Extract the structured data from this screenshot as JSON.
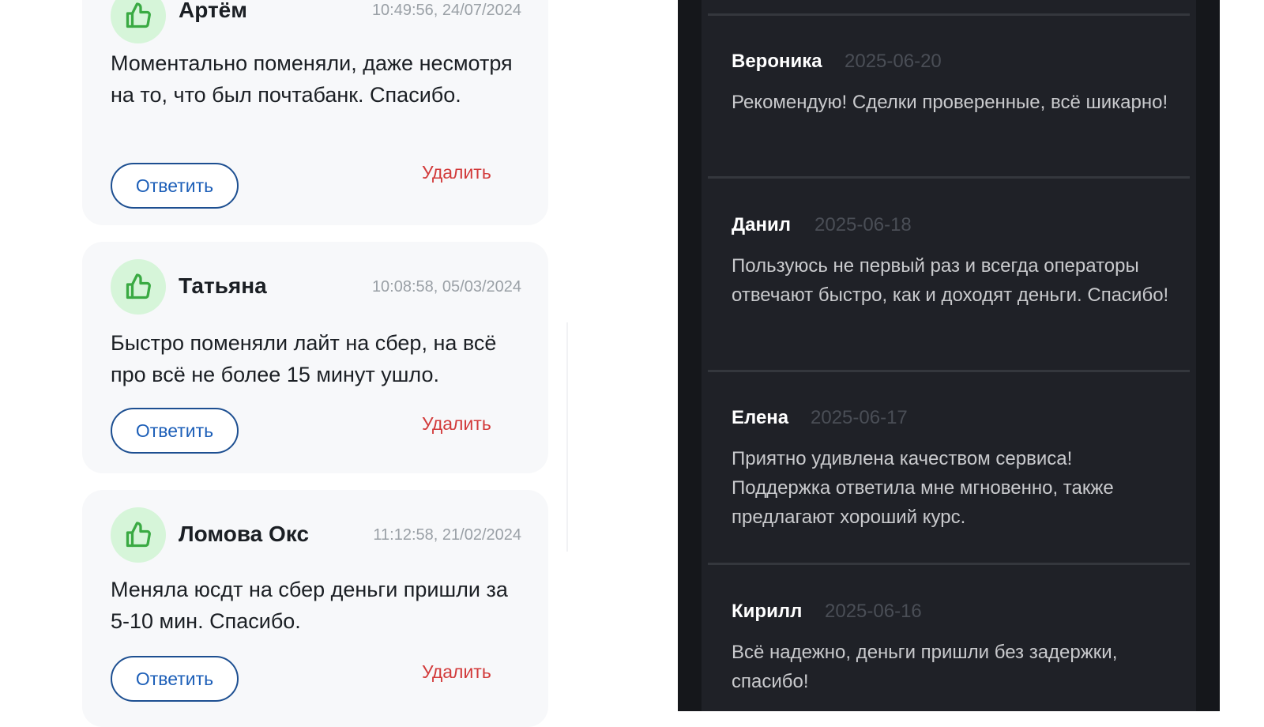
{
  "reviews_light": [
    {
      "name": "Артём",
      "date": "10:49:56, 24/07/2024",
      "text": "Моментально поменяли, даже несмотря на то, что был почтабанк. Спасибо.",
      "reply_label": "Ответить",
      "delete_label": "Удалить"
    },
    {
      "name": "Татьяна",
      "date": "10:08:58, 05/03/2024",
      "text": "Быстро поменяли лайт на сбер, на всё про всё не более 15 минут ушло.",
      "reply_label": "Ответить",
      "delete_label": "Удалить"
    },
    {
      "name": "Ломова Окс",
      "date": "11:12:58, 21/02/2024",
      "text": "Меняла юсдт на сбер деньги пришли за 5-10 мин. Спасибо.",
      "reply_label": "Ответить",
      "delete_label": "Удалить"
    }
  ],
  "reviews_dark": [
    {
      "name": "Вероника",
      "date": "2025-06-20",
      "text": "Рекомендую! Сделки проверенные, всё шикарно!"
    },
    {
      "name": "Данил",
      "date": "2025-06-18",
      "text": "Пользуюсь не первый раз и всегда операторы отвечают быстро, как и доходят деньги. Спасибо!"
    },
    {
      "name": "Елена",
      "date": "2025-06-17",
      "text": "Приятно удивлена качеством сервиса! Поддержка ответила мне мгновенно, также предлагают хороший курс."
    },
    {
      "name": "Кирилл",
      "date": "2025-06-16",
      "text": "Всё надежно, деньги пришли без задержки, спасибо!"
    }
  ],
  "colors": {
    "like_bg": "#d6f5d9",
    "like_icon": "#3aaa43",
    "reply_text": "#1d5fb8",
    "delete_text": "#d23a3a",
    "dark_panel": "#1f2127"
  },
  "icons": {
    "like": "thumbs-up-icon"
  }
}
